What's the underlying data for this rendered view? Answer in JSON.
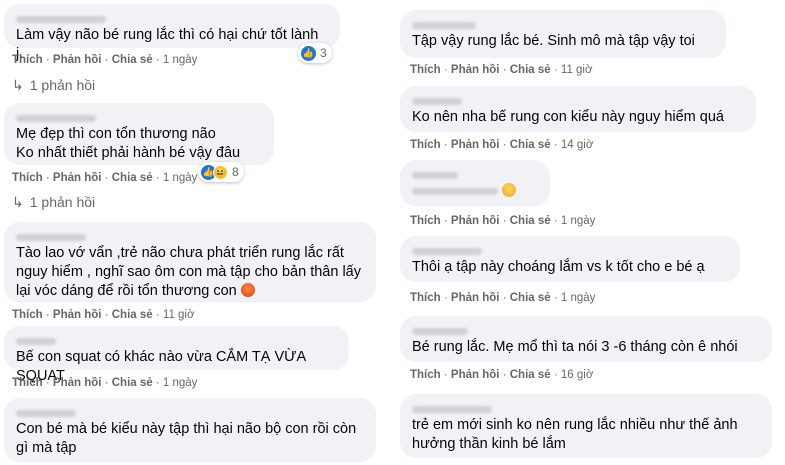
{
  "left": [
    {
      "text": "Làm vậy não bé rung lắc thì có hại chứ tốt lành j.",
      "reaction_count": "3",
      "actions": {
        "like": "Thích",
        "reply": "Phản hồi",
        "share": "Chia sẻ",
        "time": "1 ngày"
      },
      "replies": "1 phản hồi"
    },
    {
      "text": "Mẹ đẹp thì con tổn thương não\nKo nhất thiết phải hành bé vậy đâu",
      "reaction_count": "8",
      "actions": {
        "like": "Thích",
        "reply": "Phản hồi",
        "share": "Chia sẻ",
        "time": "1 ngày"
      },
      "replies": "1 phản hồi"
    },
    {
      "text": "Tào lao vớ vẩn ,trẻ não chưa phát triển rung lắc rất nguy hiểm , nghĩ sao ôm con mà tập cho bản thân lấy lại vóc dáng để rồi tổn thương con",
      "actions": {
        "like": "Thích",
        "reply": "Phản hồi",
        "share": "Chia sẻ",
        "time": "11 giờ"
      }
    },
    {
      "text": "Bế con squat có khác nào vừa CẮM TẠ VỪA SQUAT",
      "actions": {
        "like": "Thích",
        "reply": "Phản hồi",
        "share": "Chia sẻ",
        "time": "1 ngày"
      }
    },
    {
      "text": "Con bé mà bé kiểu này tập thì hại não bộ con rồi còn gì mà tập"
    }
  ],
  "right": [
    {
      "text": "Tập vậy rung lắc bé. Sinh mô mà tập vậy toi",
      "actions": {
        "like": "Thích",
        "reply": "Phản hồi",
        "share": "Chia sẻ",
        "time": "11 giờ"
      }
    },
    {
      "text": "Ko nên nha bế rung con kiểu này nguy hiểm quá",
      "actions": {
        "like": "Thích",
        "reply": "Phản hồi",
        "share": "Chia sẻ",
        "time": "14 giờ"
      }
    },
    {
      "text": "",
      "actions": {
        "like": "Thích",
        "reply": "Phản hồi",
        "share": "Chia sẻ",
        "time": "1 ngày"
      }
    },
    {
      "text": "Thôi ạ tập này choáng lắm vs k tốt cho e bé ạ",
      "actions": {
        "like": "Thích",
        "reply": "Phản hồi",
        "share": "Chia sẻ",
        "time": "1 ngày"
      }
    },
    {
      "text": "Bé rung lắc. Mẹ mổ thì ta nói 3 -6 tháng còn ê nhói",
      "actions": {
        "like": "Thích",
        "reply": "Phản hồi",
        "share": "Chia sẻ",
        "time": "16 giờ"
      }
    },
    {
      "text": "trẻ em mới sinh ko nên rung lắc nhiều như thế ảnh hưởng thần kinh bé lắm"
    }
  ],
  "separator": "·",
  "icons": {
    "like": "like-reaction-icon",
    "haha": "haha-reaction-icon",
    "angry": "angry-emoji-icon",
    "sad": "sad-emoji-icon",
    "reply_arrow": "reply-arrow-icon"
  },
  "colors": {
    "bubble": "#f0f2f5",
    "meta": "#65676b",
    "like": "#1b74e4"
  }
}
